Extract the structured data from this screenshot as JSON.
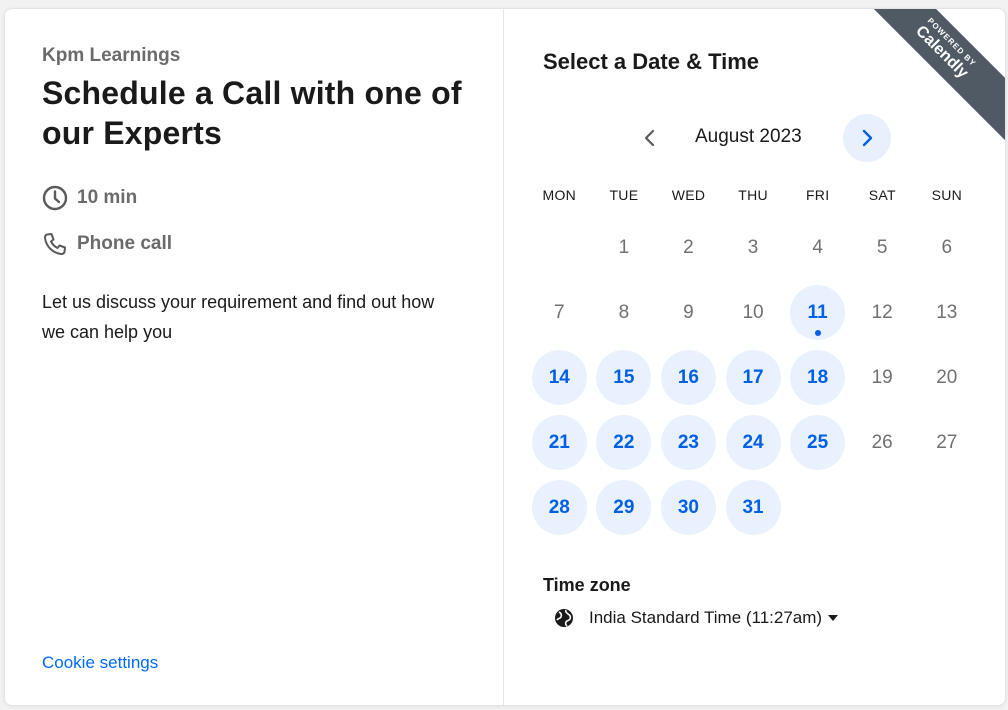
{
  "event": {
    "organizer": "Kpm Learnings",
    "title": "Schedule a Call with one of our Experts",
    "duration": "10 min",
    "location": "Phone call",
    "description": "Let us discuss your requirement and find out how we can help you",
    "cookie_link": "Cookie settings"
  },
  "calendar": {
    "heading": "Select a Date & Time",
    "month_label": "August 2023",
    "weekdays": [
      "MON",
      "TUE",
      "WED",
      "THU",
      "FRI",
      "SAT",
      "SUN"
    ],
    "weeks": [
      [
        {
          "d": ""
        },
        {
          "d": "1"
        },
        {
          "d": "2"
        },
        {
          "d": "3"
        },
        {
          "d": "4"
        },
        {
          "d": "5"
        },
        {
          "d": "6"
        }
      ],
      [
        {
          "d": "7"
        },
        {
          "d": "8"
        },
        {
          "d": "9"
        },
        {
          "d": "10"
        },
        {
          "d": "11",
          "avail": true,
          "today": true
        },
        {
          "d": "12"
        },
        {
          "d": "13"
        }
      ],
      [
        {
          "d": "14",
          "avail": true
        },
        {
          "d": "15",
          "avail": true
        },
        {
          "d": "16",
          "avail": true
        },
        {
          "d": "17",
          "avail": true
        },
        {
          "d": "18",
          "avail": true
        },
        {
          "d": "19"
        },
        {
          "d": "20"
        }
      ],
      [
        {
          "d": "21",
          "avail": true
        },
        {
          "d": "22",
          "avail": true
        },
        {
          "d": "23",
          "avail": true
        },
        {
          "d": "24",
          "avail": true
        },
        {
          "d": "25",
          "avail": true
        },
        {
          "d": "26"
        },
        {
          "d": "27"
        }
      ],
      [
        {
          "d": "28",
          "avail": true
        },
        {
          "d": "29",
          "avail": true
        },
        {
          "d": "30",
          "avail": true
        },
        {
          "d": "31",
          "avail": true
        },
        {
          "d": ""
        },
        {
          "d": ""
        },
        {
          "d": ""
        }
      ]
    ]
  },
  "timezone": {
    "label": "Time zone",
    "value": "India Standard Time (11:27am)"
  },
  "badge": {
    "line1": "POWERED BY",
    "line2": "Calendly"
  },
  "colors": {
    "accent": "#0060e6",
    "available_bg": "#e9f1fe",
    "ribbon": "#4f5a65"
  }
}
